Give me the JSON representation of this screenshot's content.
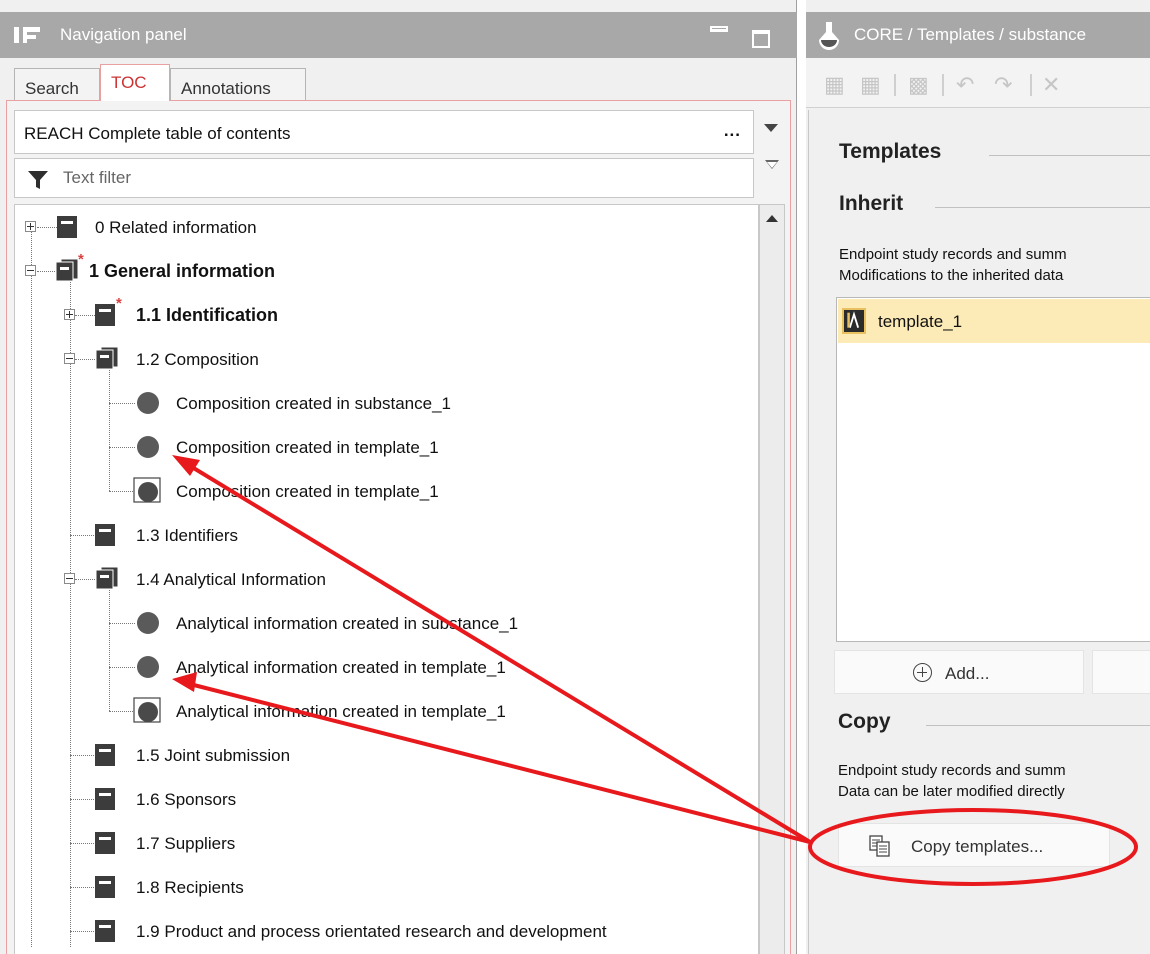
{
  "nav": {
    "title": "Navigation panel",
    "tabs": [
      {
        "label": "Search"
      },
      {
        "label": "TOC"
      },
      {
        "label": "Annotations"
      }
    ],
    "toc_select": {
      "value": "REACH Complete table of contents",
      "more": "..."
    },
    "filter": {
      "placeholder": "Text filter"
    },
    "tree": [
      {
        "label": "0 Related information"
      },
      {
        "label": "1 General information"
      },
      {
        "label": "1.1 Identification"
      },
      {
        "label": "1.2 Composition"
      },
      {
        "label": "Composition created in substance_1"
      },
      {
        "label": "Composition created in template_1"
      },
      {
        "label": "Composition created in template_1"
      },
      {
        "label": "1.3 Identifiers"
      },
      {
        "label": "1.4 Analytical Information"
      },
      {
        "label": "Analytical information created in substance_1"
      },
      {
        "label": "Analytical information created in template_1"
      },
      {
        "label": "Analytical information created in template_1"
      },
      {
        "label": "1.5 Joint submission"
      },
      {
        "label": "1.6 Sponsors"
      },
      {
        "label": "1.7 Suppliers"
      },
      {
        "label": "1.8 Recipients"
      },
      {
        "label": "1.9 Product and process orientated research and development"
      }
    ]
  },
  "right": {
    "title": "CORE / Templates / substance",
    "templates_heading": "Templates",
    "inherit_heading": "Inherit",
    "inherit_desc": [
      "Endpoint study records and summ",
      "Modifications to the inherited data"
    ],
    "template_items": [
      {
        "label": "template_1"
      }
    ],
    "add_button": "Add...",
    "copy_heading": "Copy",
    "copy_desc": [
      "Endpoint study records and summ",
      "Data can be later modified directly"
    ],
    "copy_button": "Copy templates..."
  },
  "annotation": {
    "color": "#e8191c"
  }
}
